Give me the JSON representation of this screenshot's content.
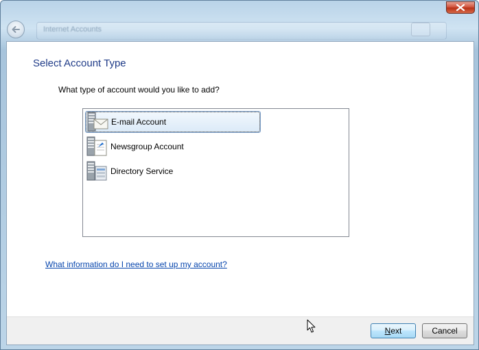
{
  "window": {
    "title": "Internet Accounts",
    "close_icon": "close-icon",
    "back_icon": "back-arrow-icon"
  },
  "page": {
    "title": "Select Account Type",
    "question": "What type of account would you like to add?"
  },
  "account_types": [
    {
      "label": "E-mail Account",
      "icon": "email-server-icon",
      "selected": true
    },
    {
      "label": "Newsgroup Account",
      "icon": "newsgroup-server-icon",
      "selected": false
    },
    {
      "label": "Directory Service",
      "icon": "directory-server-icon",
      "selected": false
    }
  ],
  "help_link": "What information do I need to set up my account?",
  "buttons": {
    "next_mnemonic": "N",
    "next_rest": "ext",
    "cancel": "Cancel"
  },
  "colors": {
    "title": "#1e3a87",
    "link": "#0645ad",
    "selection": "#dbeaf8"
  }
}
